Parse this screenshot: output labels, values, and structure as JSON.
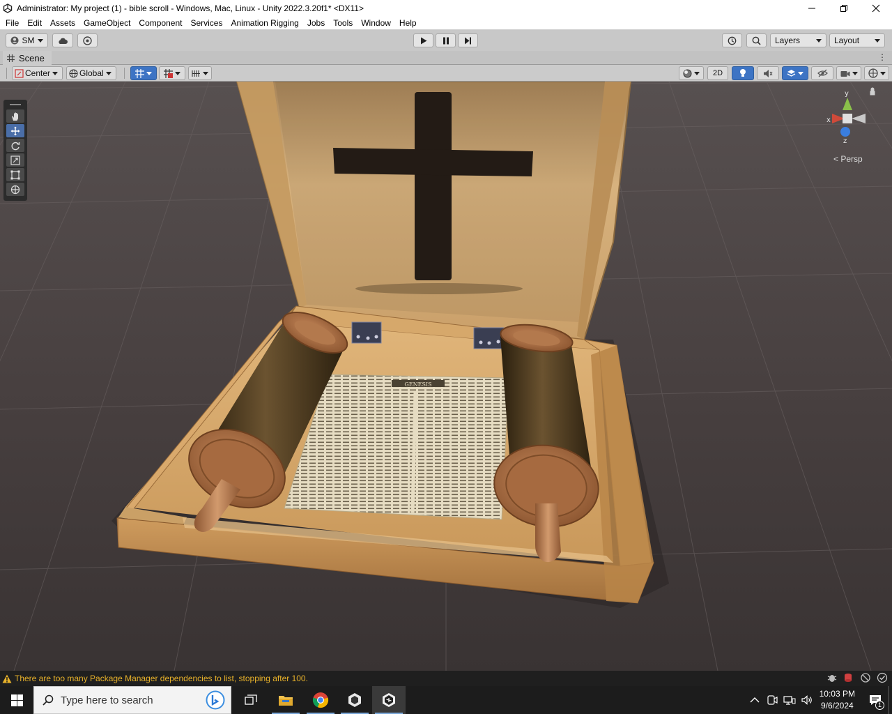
{
  "window": {
    "title": "Administrator: My project (1) - bible scroll - Windows, Mac, Linux - Unity 2022.3.20f1* <DX11>"
  },
  "menu": [
    "File",
    "Edit",
    "Assets",
    "GameObject",
    "Component",
    "Services",
    "Animation Rigging",
    "Jobs",
    "Tools",
    "Window",
    "Help"
  ],
  "toolbar": {
    "account_label": "SM",
    "layers_label": "Layers",
    "layout_label": "Layout"
  },
  "scene_tab": {
    "label": "Scene"
  },
  "scene_toolbar": {
    "pivot_label": "Center",
    "space_label": "Global",
    "mode_2d_label": "2D"
  },
  "gizmo": {
    "axis_x": "x",
    "axis_y": "y",
    "axis_z": "z",
    "projection_label": "Persp"
  },
  "scene": {
    "paper_heading": "GENESIS"
  },
  "status": {
    "message": "There are too many Package Manager dependencies to list, stopping after 100."
  },
  "taskbar": {
    "search_placeholder": "Type here to search",
    "time": "10:03 PM",
    "date": "9/6/2024",
    "notification_count": "1"
  },
  "colors": {
    "warning": "#e8b22a",
    "accent_blue": "#3d74c4",
    "status_bg": "#1f1f1f",
    "toolbar_bg": "#c8c8c8"
  }
}
